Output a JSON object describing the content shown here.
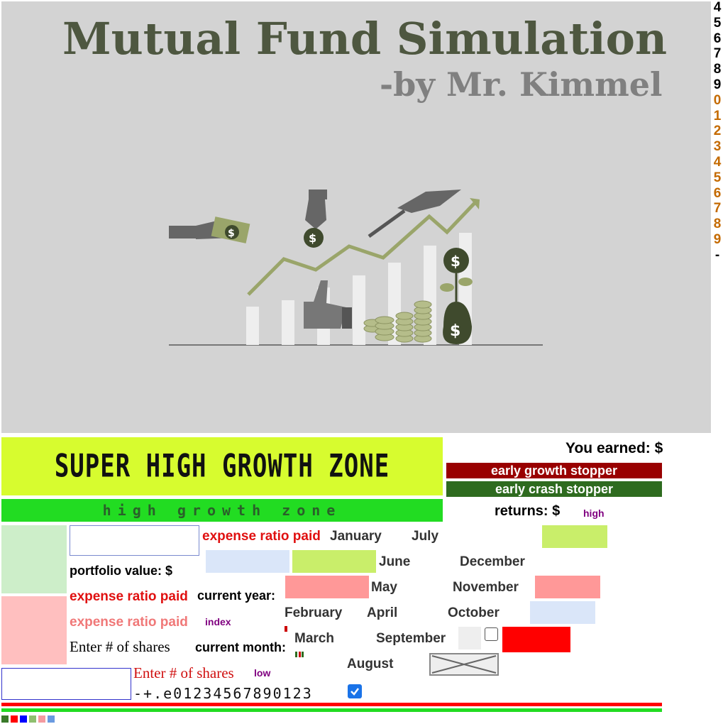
{
  "header": {
    "title": "Mutual Fund Simulation",
    "subtitle": "-by Mr. Kimmel"
  },
  "digits": [
    {
      "t": "4",
      "c": "#000000"
    },
    {
      "t": "5",
      "c": "#000000"
    },
    {
      "t": "6",
      "c": "#000000"
    },
    {
      "t": "7",
      "c": "#000000"
    },
    {
      "t": "8",
      "c": "#000000"
    },
    {
      "t": "9",
      "c": "#000000"
    },
    {
      "t": "0",
      "c": "#c46a00"
    },
    {
      "t": "1",
      "c": "#c46a00"
    },
    {
      "t": "2",
      "c": "#c46a00"
    },
    {
      "t": "3",
      "c": "#c46a00"
    },
    {
      "t": "4",
      "c": "#c46a00"
    },
    {
      "t": "5",
      "c": "#c46a00"
    },
    {
      "t": "6",
      "c": "#c46a00"
    },
    {
      "t": "7",
      "c": "#c46a00"
    },
    {
      "t": "8",
      "c": "#c46a00"
    },
    {
      "t": "9",
      "c": "#c46a00"
    },
    {
      "t": "-",
      "c": "#000000"
    }
  ],
  "zones": {
    "super": "SUPER HIGH GROWTH ZONE",
    "high": "high growth zone"
  },
  "earned": {
    "label": "You earned:",
    "value": "$"
  },
  "buttons": {
    "early_growth": "early growth stopper",
    "early_crash": "early crash stopper"
  },
  "returns": {
    "label": "returns: $",
    "tag": "high"
  },
  "labels": {
    "expense_ratio": "expense ratio paid",
    "portfolio_value": "portfolio value: $",
    "current_year": "current year:",
    "current_month": "current month:",
    "enter_shares": "Enter # of shares",
    "index": "index",
    "low": "low",
    "number_keys": "-+.e01234567890123"
  },
  "months": {
    "january": "January",
    "february": "February",
    "march": "March",
    "april": "April",
    "may": "May",
    "june": "June",
    "july": "July",
    "august": "August",
    "september": "September",
    "october": "October",
    "november": "November",
    "december": "December"
  },
  "colors": {
    "banner": "#d3d3d3",
    "title": "#4e5740",
    "super_zone": "#d7fc2f",
    "high_zone": "#22dc22",
    "light_green": "#cdeec9",
    "light_red": "#ffbfbf",
    "lime": "#c9ee6a",
    "light_blue": "#dae6f9",
    "salmon": "#ff9898",
    "bright_red": "#ff0000"
  },
  "legend_swatches": [
    "#3a7a2a",
    "#ff0000",
    "#0000ff",
    "#8fbf6f",
    "#f49aa0",
    "#6a9ae0"
  ]
}
